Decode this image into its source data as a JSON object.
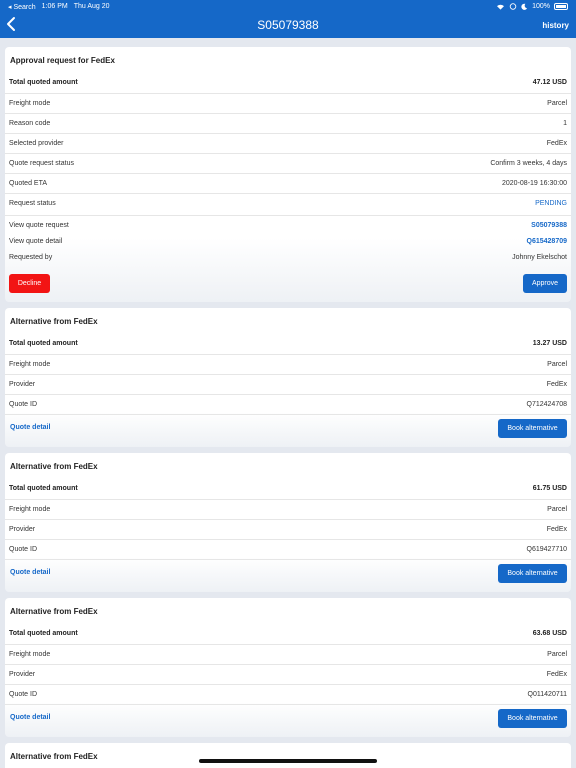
{
  "status_bar": {
    "back_app": "◂ Search",
    "time": "1:06 PM",
    "date": "Thu Aug 20",
    "battery": "100%"
  },
  "nav": {
    "title": "S05079388",
    "history_label": "history"
  },
  "approval": {
    "title": "Approval request for FedEx",
    "rows": [
      {
        "label": "Total quoted amount",
        "value": "47.12 USD"
      },
      {
        "label": "Freight mode",
        "value": "Parcel"
      },
      {
        "label": "Reason code",
        "value": "1"
      },
      {
        "label": "Selected provider",
        "value": "FedEx"
      },
      {
        "label": "Quote request status",
        "value": "Confirm 3 weeks, 4 days"
      },
      {
        "label": "Quoted ETA",
        "value": "2020-08-19 16:30:00"
      },
      {
        "label": "Request status",
        "value": "PENDING"
      },
      {
        "label": "View quote request",
        "value": "S05079388"
      },
      {
        "label": "View quote detail",
        "value": "Q615428709"
      },
      {
        "label": "Requested by",
        "value": "Johnny Ekelschot"
      }
    ],
    "decline_label": "Decline",
    "approve_label": "Approve"
  },
  "alternatives": [
    {
      "title": "Alternative from FedEx",
      "rows": [
        {
          "label": "Total quoted amount",
          "value": "13.27 USD"
        },
        {
          "label": "Freight mode",
          "value": "Parcel"
        },
        {
          "label": "Provider",
          "value": "FedEx"
        },
        {
          "label": "Quote ID",
          "value": "Q712424708"
        }
      ],
      "detail_label": "Quote detail",
      "book_label": "Book alternative"
    },
    {
      "title": "Alternative from FedEx",
      "rows": [
        {
          "label": "Total quoted amount",
          "value": "61.75 USD"
        },
        {
          "label": "Freight mode",
          "value": "Parcel"
        },
        {
          "label": "Provider",
          "value": "FedEx"
        },
        {
          "label": "Quote ID",
          "value": "Q619427710"
        }
      ],
      "detail_label": "Quote detail",
      "book_label": "Book alternative"
    },
    {
      "title": "Alternative from FedEx",
      "rows": [
        {
          "label": "Total quoted amount",
          "value": "63.68 USD"
        },
        {
          "label": "Freight mode",
          "value": "Parcel"
        },
        {
          "label": "Provider",
          "value": "FedEx"
        },
        {
          "label": "Quote ID",
          "value": "Q011420711"
        }
      ],
      "detail_label": "Quote detail",
      "book_label": "Book alternative"
    },
    {
      "title": "Alternative from FedEx"
    }
  ],
  "colors": {
    "accent": "#1568c8",
    "decline": "#f21414",
    "background": "#e4e8ef"
  }
}
